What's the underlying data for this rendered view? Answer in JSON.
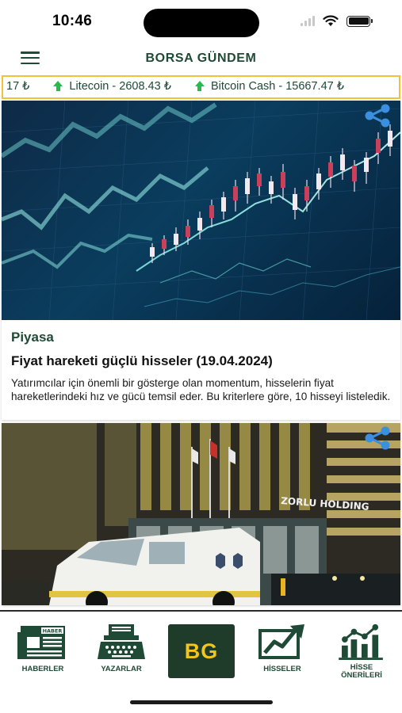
{
  "status_bar": {
    "time": "10:46"
  },
  "header": {
    "title": "BORSA GÜNDEM",
    "menu_icon": "hamburger-menu-icon"
  },
  "ticker": {
    "items": [
      {
        "text": "17 ₺",
        "arrow": false
      },
      {
        "text": "Litecoin - 2608.43 ₺",
        "arrow": true
      },
      {
        "text": "Bitcoin Cash - 15667.47 ₺",
        "arrow": true
      }
    ],
    "border_color": "#f0c13a",
    "up_color": "#2db84e"
  },
  "articles": [
    {
      "category": "Piyasa",
      "title": "Fiyat hareketi güçlü hisseler (19.04.2024)",
      "summary": "Yatırımcılar için önemli bir gösterge olan momentum, hisselerin fiyat hareketlerindeki hız ve gücü temsil eder. Bu kriterlere göre, 10 hisseyi listeledik.",
      "image": "stock-chart-photo"
    },
    {
      "image": "zorlu-holding-building-photo",
      "sign_text": "ZORLU HOLDING"
    }
  ],
  "bottom_nav": {
    "items": [
      {
        "label": "HABERLER",
        "icon": "newspaper-icon"
      },
      {
        "label": "YAZARLAR",
        "icon": "typewriter-icon"
      },
      {
        "label": "BG",
        "icon": "logo"
      },
      {
        "label": "HİSSELER",
        "icon": "trend-chart-icon"
      },
      {
        "label": "HİSSE ÖNERİLERİ",
        "icon": "bar-line-chart-icon"
      }
    ],
    "newspaper_masthead": "HABER"
  },
  "colors": {
    "brand_green": "#1e4a36",
    "logo_bg": "#1f3b2a",
    "logo_text": "#f5c518"
  }
}
